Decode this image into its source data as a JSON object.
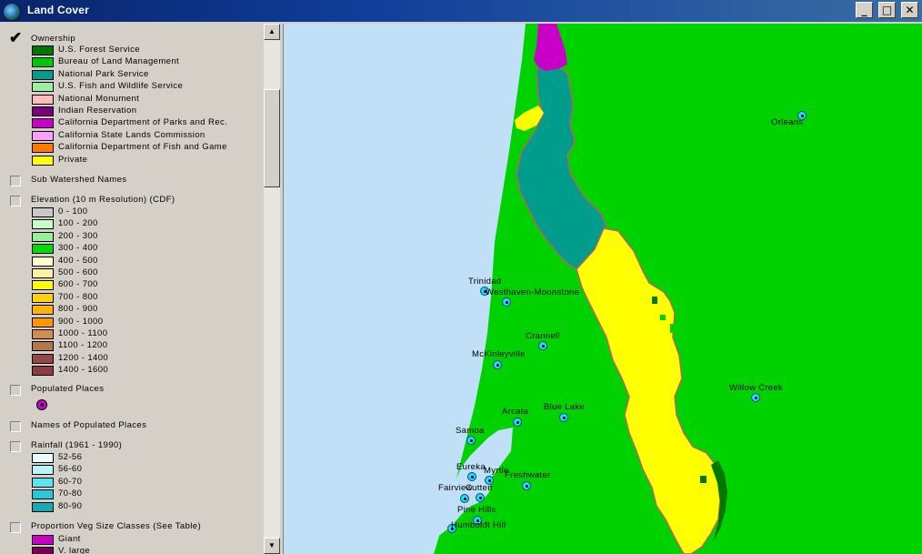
{
  "window": {
    "title": "Land Cover",
    "min": "_",
    "max": "□",
    "close": "✕"
  },
  "scroll": {
    "up": "▲",
    "down": "▼"
  },
  "legend": {
    "ownership": {
      "title": "Ownership",
      "checked": true,
      "check_glyph": "✔",
      "items": [
        {
          "label": "U.S. Forest Service",
          "color": "#007800"
        },
        {
          "label": "Bureau of Land Management",
          "color": "#00c800"
        },
        {
          "label": "National Park Service",
          "color": "#009d8c"
        },
        {
          "label": "U.S. Fish and Wildlife Service",
          "color": "#9cf0a0"
        },
        {
          "label": "National Monument",
          "color": "#ffbcbc"
        },
        {
          "label": "Indian Reservation",
          "color": "#780078"
        },
        {
          "label": "California Department of Parks and Rec.",
          "color": "#c800c8"
        },
        {
          "label": "California State Lands Commission",
          "color": "#ffa0ff"
        },
        {
          "label": "California Department of Fish and Game",
          "color": "#ff7800"
        },
        {
          "label": "Private",
          "color": "#ffff00"
        }
      ]
    },
    "sub_watershed": {
      "title": "Sub Watershed Names",
      "checked": false
    },
    "elevation": {
      "title": "Elevation (10 m Resolution) (CDF)",
      "checked": false,
      "items": [
        {
          "label": "0 - 100",
          "color": "#c8c8c8"
        },
        {
          "label": "100 - 200",
          "color": "#c8ffc8"
        },
        {
          "label": "200 - 300",
          "color": "#96f096"
        },
        {
          "label": "300 - 400",
          "color": "#00dc00"
        },
        {
          "label": "400 - 500",
          "color": "#ffffc8"
        },
        {
          "label": "500 - 600",
          "color": "#fff0a0"
        },
        {
          "label": "600 - 700",
          "color": "#ffff00"
        },
        {
          "label": "700 - 800",
          "color": "#ffd200"
        },
        {
          "label": "800 - 900",
          "color": "#ffb400"
        },
        {
          "label": "900 - 1000",
          "color": "#ff9600"
        },
        {
          "label": "1000 - 1100",
          "color": "#d28c50"
        },
        {
          "label": "1100 - 1200",
          "color": "#b47846"
        },
        {
          "label": "1200 - 1400",
          "color": "#964646"
        },
        {
          "label": "1400 - 1600",
          "color": "#8c3c46"
        }
      ]
    },
    "populated_places": {
      "title": "Populated Places",
      "checked": false
    },
    "names_populated": {
      "title": "Names of Populated Places",
      "checked": false
    },
    "rainfall": {
      "title": "Rainfall (1961 - 1990)",
      "checked": false,
      "items": [
        {
          "label": "52-56",
          "color": "#e6ffff"
        },
        {
          "label": "56-60",
          "color": "#b4f5ff"
        },
        {
          "label": "60-70",
          "color": "#5ae6f0"
        },
        {
          "label": "70-80",
          "color": "#28c8dc"
        },
        {
          "label": "80-90",
          "color": "#14aab4"
        }
      ]
    },
    "veg_size": {
      "title": "Proportion Veg Size Classes (See Table)",
      "checked": false,
      "items": [
        {
          "label": "Giant",
          "color": "#c800c8"
        },
        {
          "label": "V. large",
          "color": "#780050"
        }
      ]
    }
  },
  "map": {
    "colors": {
      "ocean": "#c0e0f8",
      "blm": "#00d200",
      "usfs": "#007800",
      "nps": "#009d8c",
      "private": "#ffff00",
      "parks": "#c800c8",
      "boundary": "#b46464"
    },
    "places": [
      "Orleans",
      "Trinidad",
      "Westhaven-Moonstone",
      "Crannell",
      "McKinleyville",
      "Willow Creek",
      "Blue Lake",
      "Arcata",
      "Samoa",
      "Eureka",
      "Myrtle",
      "Freshwater",
      "Cutten",
      "Fairview",
      "Pine Hills",
      "Humboldt Hill"
    ]
  }
}
